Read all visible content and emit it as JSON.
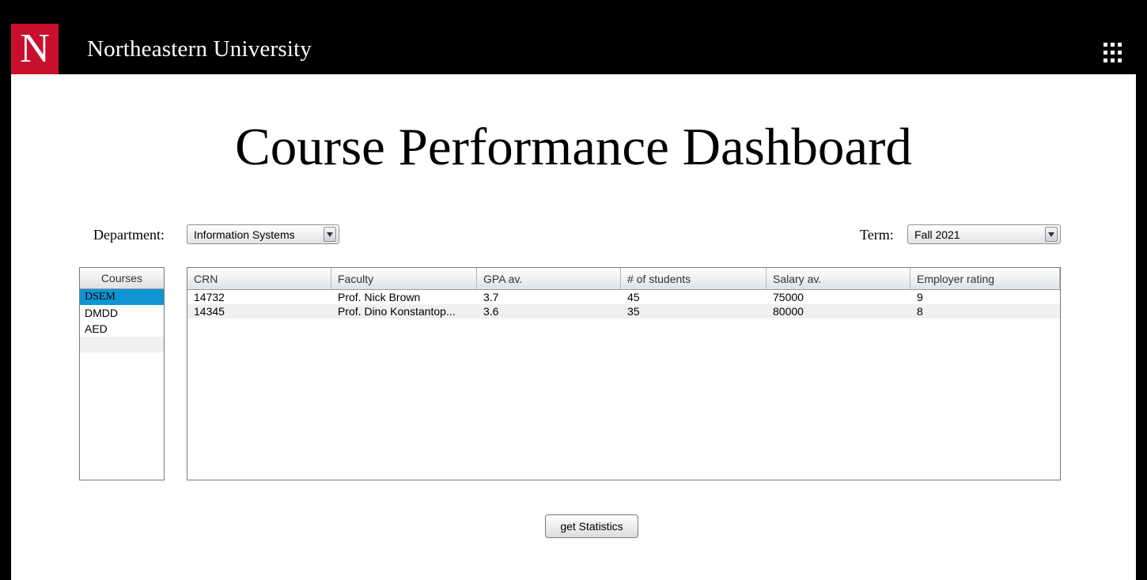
{
  "header": {
    "logo_letter": "N",
    "brand": "Northeastern University",
    "menu_icon": "grid-dots-icon"
  },
  "page": {
    "title": "Course Performance Dashboard"
  },
  "filters": {
    "department_label": "Department:",
    "department_value": "Information Systems",
    "term_label": "Term:",
    "term_value": "Fall 2021"
  },
  "courses": {
    "header": "Courses",
    "items": [
      "DSEM",
      "DMDD",
      "AED"
    ],
    "selected": "DSEM"
  },
  "table": {
    "columns": [
      "CRN",
      "Faculty",
      "GPA av.",
      "# of students",
      "Salary av.",
      "Employer rating"
    ],
    "rows": [
      [
        "14732",
        "Prof. Nick Brown",
        "3.7",
        "45",
        "75000",
        "9"
      ],
      [
        "14345",
        "Prof. Dino Konstantop...",
        "3.6",
        "35",
        "80000",
        "8"
      ]
    ]
  },
  "actions": {
    "stats_button": "get Statistics"
  },
  "colors": {
    "brand_red": "#c8102e",
    "selection_blue": "#0e95d4",
    "header_black": "#000000"
  }
}
